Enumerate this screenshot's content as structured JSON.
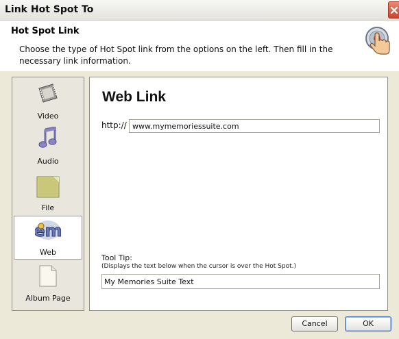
{
  "window": {
    "title": "Link Hot Spot To"
  },
  "header": {
    "title": "Hot Spot Link",
    "description": "Choose the type of Hot Spot link from the options on the left. Then fill in the necessary link information."
  },
  "sidebar": {
    "selected": "Web",
    "items": [
      {
        "label": "Video",
        "icon": "film-strip-icon"
      },
      {
        "label": "Audio",
        "icon": "music-note-icon"
      },
      {
        "label": "File",
        "icon": "folder-icon"
      },
      {
        "label": "Web",
        "icon": "web-logo-icon"
      },
      {
        "label": "Album Page",
        "icon": "page-icon"
      }
    ]
  },
  "content": {
    "heading": "Web Link",
    "url_prefix": "http://",
    "url_value": "www.mymemoriessuite.com",
    "tooltip_label": "Tool Tip:",
    "tooltip_hint": "(Displays the text below when the cursor is over the Hot Spot.)",
    "tooltip_value": "My Memories Suite Text"
  },
  "buttons": {
    "cancel": "Cancel",
    "ok": "OK"
  },
  "colors": {
    "dialog_bg": "#ece9d8",
    "close_button": "#c7452c",
    "ok_border": "#3a6bc9"
  }
}
